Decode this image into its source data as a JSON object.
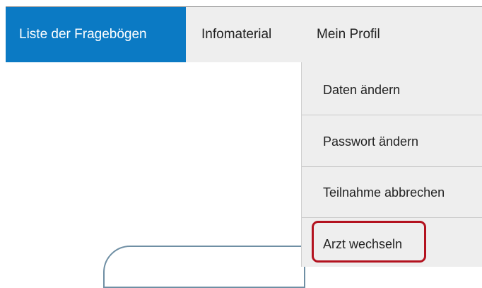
{
  "nav": {
    "items": [
      {
        "label": "Liste der Fragebögen",
        "active": true
      },
      {
        "label": "Infomaterial",
        "active": false
      },
      {
        "label": "Mein Profil",
        "active": false
      }
    ],
    "active_color": "#0b7ac4",
    "bar_color": "#eeeeee"
  },
  "profile_menu": {
    "items": [
      {
        "label": "Daten ändern"
      },
      {
        "label": "Passwort ändern"
      },
      {
        "label": "Teilnahme abbrechen"
      },
      {
        "label": "Arzt wechseln"
      }
    ],
    "highlight_color": "#b3121f"
  }
}
